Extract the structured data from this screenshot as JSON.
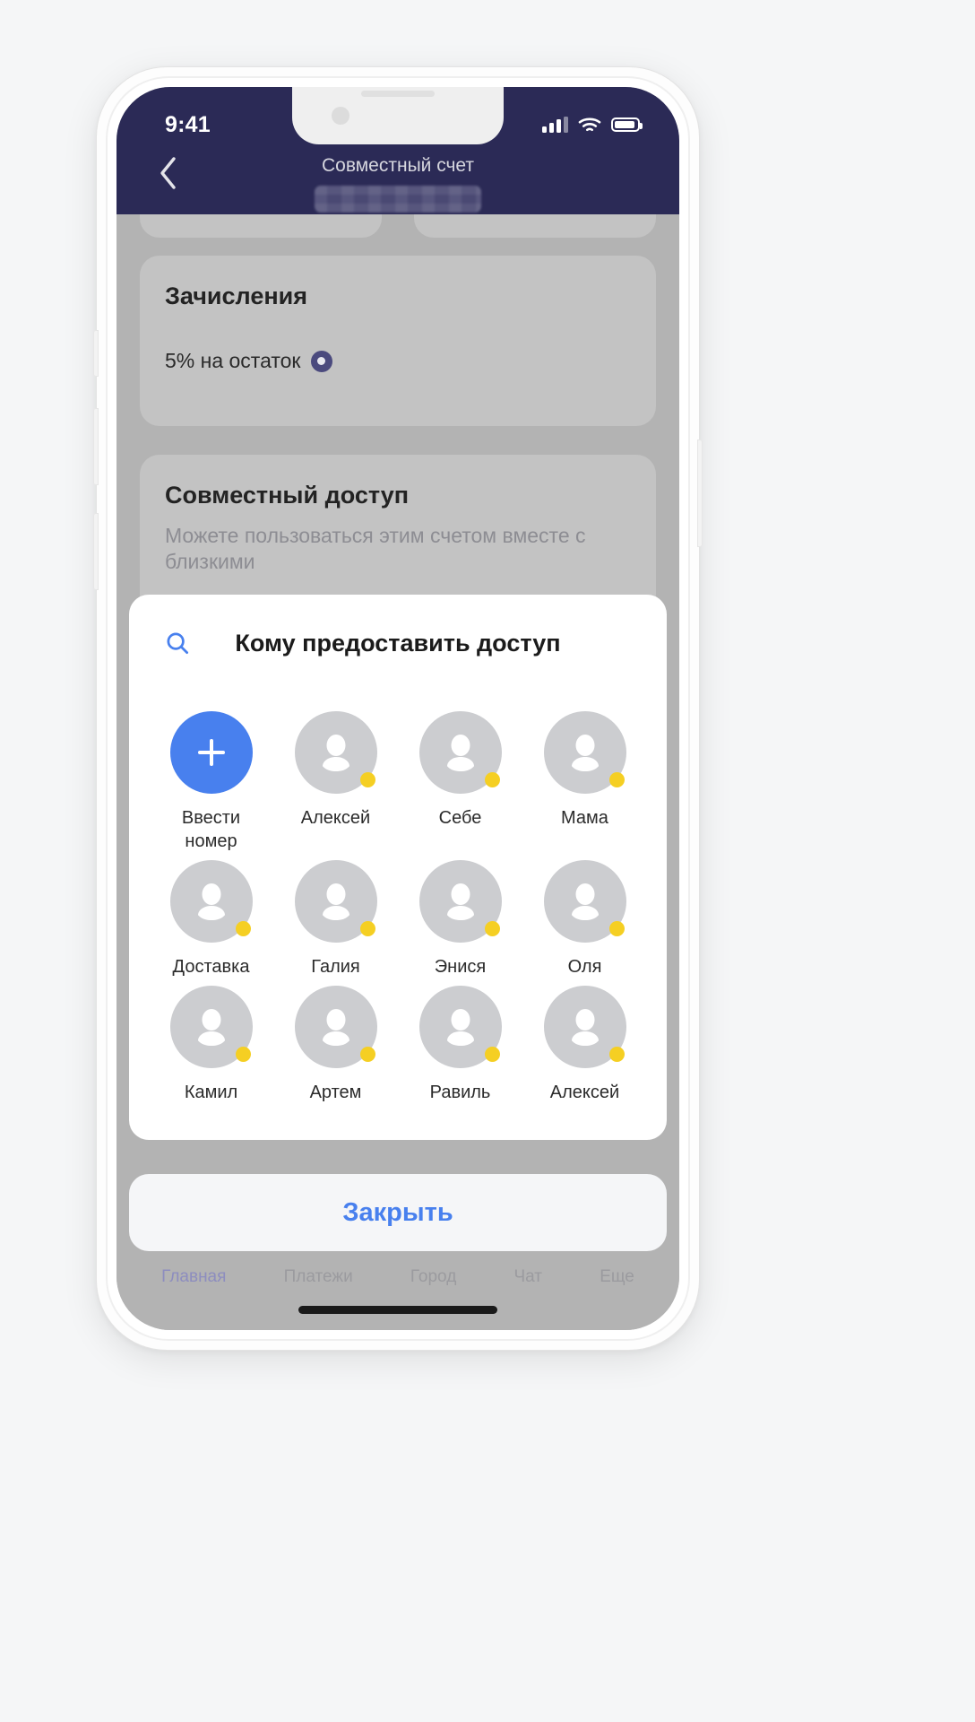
{
  "status_bar": {
    "time": "9:41",
    "signal_icon": "cellular-signal-icon",
    "wifi_icon": "wifi-icon",
    "battery_icon": "battery-icon"
  },
  "nav": {
    "back_icon": "chevron-left-icon",
    "title": "Совместный счет",
    "subtitle_redacted": ""
  },
  "page": {
    "cards": [
      {
        "title": "Зачисления",
        "row_label": "5% на остаток",
        "badge_icon": "percent-badge-icon"
      },
      {
        "title": "Совместный доступ",
        "description": "Можете пользоваться этим счетом вместе с близкими"
      }
    ],
    "tabs": [
      {
        "label": "Главная",
        "active": true
      },
      {
        "label": "Платежи",
        "active": false
      },
      {
        "label": "Город",
        "active": false
      },
      {
        "label": "Чат",
        "active": false
      },
      {
        "label": "Еще",
        "active": false
      }
    ]
  },
  "sheet": {
    "search_icon": "search-icon",
    "title": "Кому предоставить доступ",
    "contacts": [
      {
        "label": "Ввести\nномер",
        "type": "add",
        "icon": "plus-icon",
        "has_status_dot": false
      },
      {
        "label": "Алексей",
        "type": "contact",
        "icon": "person-avatar-icon",
        "has_status_dot": true
      },
      {
        "label": "Себе",
        "type": "contact",
        "icon": "person-avatar-icon",
        "has_status_dot": true
      },
      {
        "label": "Мама",
        "type": "contact",
        "icon": "person-avatar-icon",
        "has_status_dot": true
      },
      {
        "label": "Доставка",
        "type": "contact",
        "icon": "person-avatar-icon",
        "has_status_dot": true
      },
      {
        "label": "Галия",
        "type": "contact",
        "icon": "person-avatar-icon",
        "has_status_dot": true
      },
      {
        "label": "Энися",
        "type": "contact",
        "icon": "person-avatar-icon",
        "has_status_dot": true
      },
      {
        "label": "Оля",
        "type": "contact",
        "icon": "person-avatar-icon",
        "has_status_dot": true
      },
      {
        "label": "Камил",
        "type": "contact",
        "icon": "person-avatar-icon",
        "has_status_dot": true
      },
      {
        "label": "Артем",
        "type": "contact",
        "icon": "person-avatar-icon",
        "has_status_dot": true
      },
      {
        "label": "Равиль",
        "type": "contact",
        "icon": "person-avatar-icon",
        "has_status_dot": true
      },
      {
        "label": "Алексей",
        "type": "contact",
        "icon": "person-avatar-icon",
        "has_status_dot": true
      }
    ]
  },
  "close_button": {
    "label": "Закрыть"
  },
  "colors": {
    "header_navy": "#2b2a56",
    "accent_blue": "#4880ee",
    "status_dot_yellow": "#f5cf23",
    "avatar_gray": "#cccdd0",
    "dim_overlay": "#b3b3b3"
  }
}
